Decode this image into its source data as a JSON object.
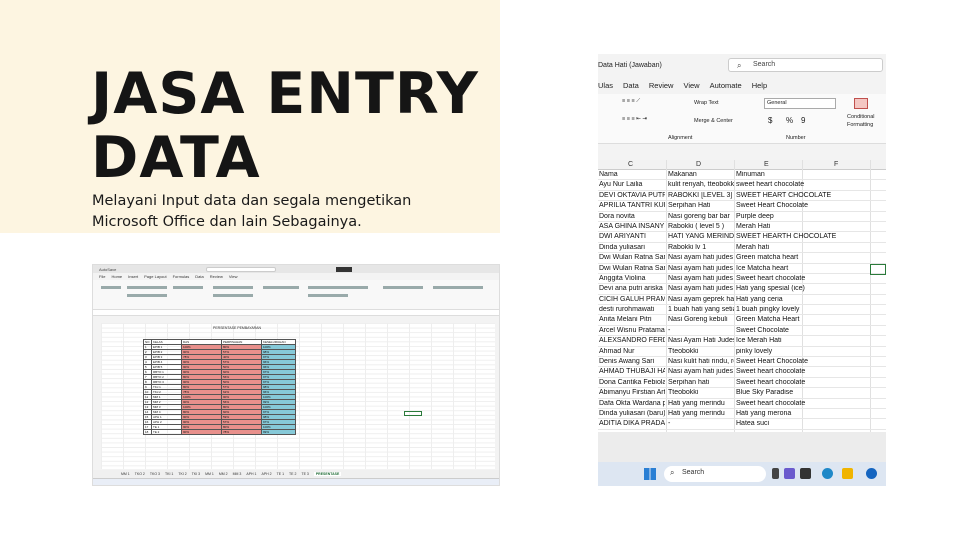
{
  "headline": "JASA ENTRY\nDATA",
  "subtitle": "Melayani Input data dan segala mengetikan Microsoft Office dan lain Sebagainya.",
  "left_screenshot": {
    "sheet_title": "PERSENTASE PEMBAYARAN",
    "header": [
      "NO",
      "KELAS",
      "DAS",
      "PERPISAHAN",
      "KESELURUHAN"
    ],
    "rows": [
      [
        "1",
        "EPIB 1",
        "100%",
        "80%",
        "100%"
      ],
      [
        "2",
        "EPIB 2",
        "90%",
        "57%",
        "98%"
      ],
      [
        "3",
        "EPIB 3",
        "78%",
        "40%",
        "97%"
      ],
      [
        "4",
        "EPIB 4",
        "90%",
        "57%",
        "96%"
      ],
      [
        "5",
        "EPIB 5",
        "90%",
        "50%",
        "96%"
      ],
      [
        "6",
        "RBTO 1",
        "90%",
        "60%",
        "97%"
      ],
      [
        "7",
        "RBTO 2",
        "80%",
        "56%",
        "97%"
      ],
      [
        "8",
        "RBTO 3",
        "90%",
        "50%",
        "97%"
      ],
      [
        "9",
        "TKJ 1",
        "80%",
        "57%",
        "98%"
      ],
      [
        "10",
        "TKJ 2",
        "78%",
        "62%",
        "96%"
      ],
      [
        "11",
        "MM 1",
        "100%",
        "90%",
        "100%"
      ],
      [
        "12",
        "MM 2",
        "90%",
        "56%",
        "99%"
      ],
      [
        "13",
        "MM 3",
        "100%",
        "80%",
        "100%"
      ],
      [
        "14",
        "MM 4",
        "80%",
        "60%",
        "97%"
      ],
      [
        "15",
        "APH 1",
        "90%",
        "59%",
        "98%"
      ],
      [
        "16",
        "APH 2",
        "90%",
        "57%",
        "97%"
      ],
      [
        "17",
        "TE 1",
        "90%",
        "80%",
        "100%"
      ],
      [
        "18",
        "TE 2",
        "90%",
        "78%",
        "99%"
      ]
    ],
    "tabs": [
      "MM 1",
      "TKO 2",
      "TKO 3",
      "TKI 1",
      "TKI 2",
      "TKI 3",
      "MM 1",
      "MM 2",
      "MM 3",
      "APH 1",
      "APH 2",
      "TE 1",
      "TE 2",
      "TE 3",
      "PRESENTASE"
    ],
    "active_tab": "PRESENTASE"
  },
  "right_screenshot": {
    "window_title": "Data Hati (Jawaban)",
    "search_placeholder": "Search",
    "menu": [
      "Ulas",
      "Data",
      "Review",
      "View",
      "Automate",
      "Help"
    ],
    "ribbon": {
      "wrap_text": "Wrap Text",
      "merge_center": "Merge & Center",
      "number_format": "General",
      "currency": "$",
      "percent": "%",
      "comma": "9",
      "conditional_1": "Conditional",
      "conditional_2": "Formatting",
      "alignment_label": "Alignment",
      "number_label": "Number"
    },
    "columns": [
      "C",
      "D",
      "E",
      "F"
    ],
    "rows": [
      [
        "Nama",
        "Makanan",
        "Minuman"
      ],
      [
        "Ayu Nur Lailia",
        "kulit renyah, tteobokki l",
        "sweet heart chocolate"
      ],
      [
        "DEVI OKTAVIA PUTRI",
        "RABOKKI [LEVEL 3]",
        "SWEET HEART CHOCOLATE"
      ],
      [
        "APRILIA TANTRI KUR",
        "Serpihan Hati",
        "Sweet Heart Chocolate"
      ],
      [
        "Dora novita",
        "Nasi goreng bar bar",
        "Purple deep"
      ],
      [
        "ASA GHINA INSANY",
        "Rabokki ( level 5 )",
        "Merah Hati"
      ],
      [
        "DWI ARIYANTI",
        "HATI YANG MERINDU",
        "SWEET HEARTH CHOCOLATE"
      ],
      [
        "Dinda yuliasari",
        "Rabokki  lv 1",
        "Merah hati"
      ],
      [
        "Dwi Wulan Ratna Sari",
        "Nasi ayam hati judes",
        "Green matcha heart"
      ],
      [
        "Dwi Wulan Ratna Sari",
        "Nasi ayam hati judes",
        "Ice Matcha heart"
      ],
      [
        "Anggita Violina",
        "Nasi ayam hati judes",
        "Sweet heart chocolate"
      ],
      [
        "Devi ana putri ariska",
        "Nasi ayam hati judes",
        "Hati yang spesial (ice)"
      ],
      [
        "CICIH GALUH PRAME",
        "Nasi ayam geprek hati",
        "Hati yang ceria"
      ],
      [
        "desti rurohmawati",
        "1 buah hati yang setia",
        "1 buah pingky lovely"
      ],
      [
        "Anita Melani Pitri",
        "Nasi Goreng kebuli",
        "Green Matcha Heart"
      ],
      [
        "Arcel Wisnu Pratama",
        "-",
        "Sweet Chocolate"
      ],
      [
        "ALEXSANDRO FERDI",
        "Nasi Ayam Hati Judes",
        "Ice Merah Hati"
      ],
      [
        "Ahmad Nur",
        "Tteobokki",
        "pinky lovely"
      ],
      [
        "Denis Awang Sari",
        "Nasi kulit hati rindu, ro",
        "Sweet Heart Chocolate"
      ],
      [
        "AHMAD THUBAJI HAK",
        "Nasi ayam hati judes",
        "Sweet heart chocolate"
      ],
      [
        "Dona Cantika Febiola",
        "Serpihan hati",
        "Sweet heart chocolate"
      ],
      [
        "Abimanyu Firstian Arta",
        "Tteobokki",
        "Blue Sky Paradise"
      ],
      [
        "Dafa Okta Wardana p",
        "Hati yang merindu",
        "Sweet heart chocolate"
      ],
      [
        "Dinda yuliasari (baru)",
        "Hati yang merindu",
        "Hati yang merona"
      ],
      [
        "ADITIA DIKA PRADAN",
        "-",
        "Hatea suci"
      ]
    ],
    "taskbar_search": "Search"
  },
  "colors": {
    "cream": "#fdf5e1",
    "red_fill": "#e8908c",
    "blue_fill": "#86c9d8",
    "excel_green": "#1e6b34"
  }
}
